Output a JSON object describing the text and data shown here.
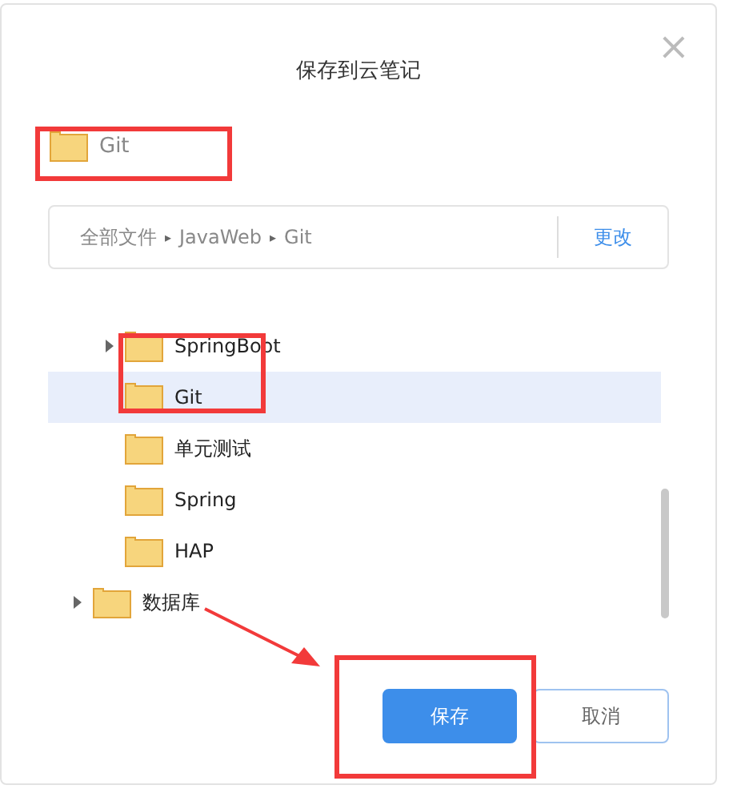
{
  "dialog": {
    "title": "保存到云笔记",
    "close": "×"
  },
  "current_folder": {
    "label": "Git"
  },
  "path": {
    "segments": [
      "全部文件",
      "JavaWeb",
      "Git"
    ],
    "separator": "▸",
    "change": "更改"
  },
  "tree": [
    {
      "children": [
        {
          "label": "SpringBoot",
          "expandable": true,
          "selected": false
        },
        {
          "label": "Git",
          "expandable": false,
          "selected": true
        },
        {
          "label": "单元测试",
          "expandable": false,
          "selected": false
        },
        {
          "label": "Spring",
          "expandable": false,
          "selected": false
        },
        {
          "label": "HAP",
          "expandable": false,
          "selected": false
        }
      ]
    },
    {
      "label": "数据库",
      "expandable": true,
      "selected": false
    }
  ],
  "buttons": [
    {
      "label": "保存",
      "kind": "primary"
    },
    {
      "label": "取消",
      "kind": "secondary"
    }
  ]
}
